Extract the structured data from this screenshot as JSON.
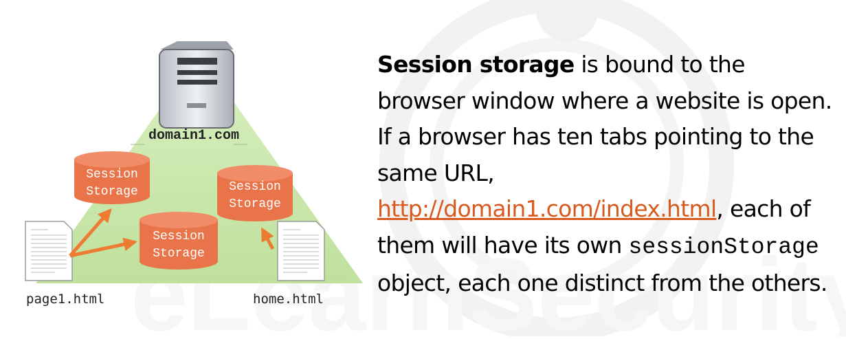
{
  "diagram": {
    "server_label": "domain1.com",
    "storage_left": {
      "line1": "Session",
      "line2": "Storage"
    },
    "storage_middle": {
      "line1": "Session",
      "line2": "Storage"
    },
    "storage_right": {
      "line1": "Session",
      "line2": "Storage"
    },
    "file_left": "page1.html",
    "file_right": "home.html"
  },
  "description": {
    "bold_term": "Session storage",
    "part1": " is bound to the browser window where a website is open. If a browser has ten tabs pointing to the same URL, ",
    "url": "http://domain1.com/index.html",
    "part2": ", each of them will have its own ",
    "code_term": "sessionStorage",
    "part3": " object, each one distinct from the others."
  },
  "colors": {
    "storage_fill": "#e9744a",
    "arrow": "#ee7b32",
    "triangle": "#c8e6a8",
    "link": "#d95a1e"
  },
  "watermark_text": "eLearnSecurity"
}
